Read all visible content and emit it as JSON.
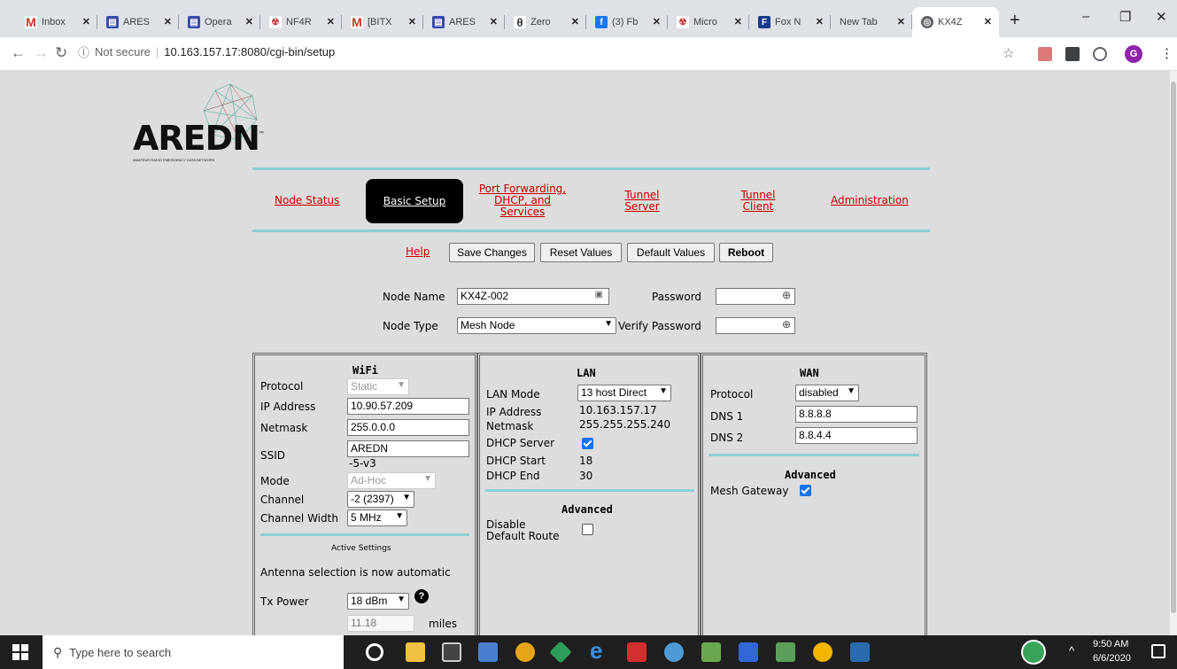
{
  "browser": {
    "tabs": [
      {
        "label": "Inbox",
        "icon": "gmail-icon",
        "color": "#d93025"
      },
      {
        "label": "ARES",
        "icon": "sheets-icon",
        "color": "#3949ab"
      },
      {
        "label": "Opera",
        "icon": "sheets-icon",
        "color": "#3949ab"
      },
      {
        "label": "NF4R",
        "icon": "bug-icon",
        "color": "#c62828"
      },
      {
        "label": "[BITX",
        "icon": "gmail-icon",
        "color": "#d93025"
      },
      {
        "label": "ARES",
        "icon": "sheets-icon",
        "color": "#3949ab"
      },
      {
        "label": "Zero",
        "icon": "theta-icon",
        "color": "#333333"
      },
      {
        "label": "(3) Fb",
        "icon": "facebook-icon",
        "color": "#1877f2"
      },
      {
        "label": "Micro",
        "icon": "bug-icon",
        "color": "#c62828"
      },
      {
        "label": "Fox N",
        "icon": "foxnews-icon",
        "color": "#1a3a8a"
      },
      {
        "label": "New Tab",
        "icon": "",
        "color": ""
      },
      {
        "label": "KX4Z",
        "icon": "globe-icon",
        "color": "#5f6368"
      }
    ],
    "new_tab": "+",
    "minimize": "–",
    "restore": "❐",
    "close": "✕",
    "not_secure": "Not secure",
    "url": "10.163.157.17:8080/cgi-bin/setup"
  },
  "logo": {
    "wordmark": "AREDN",
    "tagline": "AMATEUR RADIO EMERGENCY DATA NETWORK",
    "tm": "™"
  },
  "nav": {
    "node_status": "Node Status",
    "basic_setup": "Basic Setup",
    "port_forwarding": [
      "Port Forwarding,",
      "DHCP, and",
      "Services"
    ],
    "tunnel_server": [
      "Tunnel",
      "Server"
    ],
    "tunnel_client": [
      "Tunnel",
      "Client"
    ],
    "administration": "Administration"
  },
  "actions": {
    "help": "Help",
    "save": "Save Changes",
    "reset": "Reset Values",
    "defaults": "Default Values",
    "reboot": "Reboot"
  },
  "node": {
    "name_label": "Node Name",
    "name_value": "KX4Z-002",
    "type_label": "Node Type",
    "type_value": "Mesh Node",
    "password_label": "Password",
    "verify_label": "Verify Password"
  },
  "wifi": {
    "title": "WiFi",
    "protocol_label": "Protocol",
    "protocol_value": "Static",
    "ip_label": "IP Address",
    "ip_value": "10.90.57.209",
    "netmask_label": "Netmask",
    "netmask_value": "255.0.0.0",
    "ssid_label": "SSID",
    "ssid_value": "AREDN",
    "ssid_suffix": "-5-v3",
    "mode_label": "Mode",
    "mode_value": "Ad-Hoc",
    "channel_label": "Channel",
    "channel_value": "-2 (2397)",
    "width_label": "Channel Width",
    "width_value": "5 MHz",
    "active_settings": "Active Settings",
    "antenna_note": "Antenna selection is now automatic",
    "txpower_label": "Tx Power",
    "txpower_value": "18 dBm",
    "distance_value": "11.18",
    "distance_unit": "miles",
    "help_glyph": "?"
  },
  "lan": {
    "title": "LAN",
    "mode_label": "LAN Mode",
    "mode_value": "13 host Direct",
    "ip_label": "IP Address",
    "ip_value": "10.163.157.17",
    "netmask_label": "Netmask",
    "netmask_value": "255.255.255.240",
    "dhcp_label": "DHCP Server",
    "dhcp_start_label": "DHCP Start",
    "dhcp_start_value": "18",
    "dhcp_end_label": "DHCP End",
    "dhcp_end_value": "30",
    "advanced": "Advanced",
    "disable_route_label": [
      "Disable",
      "Default Route"
    ]
  },
  "wan": {
    "title": "WAN",
    "protocol_label": "Protocol",
    "protocol_value": "disabled",
    "dns1_label": "DNS 1",
    "dns1_value": "8.8.8.8",
    "dns2_label": "DNS 2",
    "dns2_value": "8.8.4.4",
    "advanced": "Advanced",
    "gateway_label": "Mesh Gateway"
  },
  "taskbar": {
    "search_placeholder": "Type here to search",
    "time": "9:50 AM",
    "date": "6/6/2020",
    "chevron": "^"
  }
}
